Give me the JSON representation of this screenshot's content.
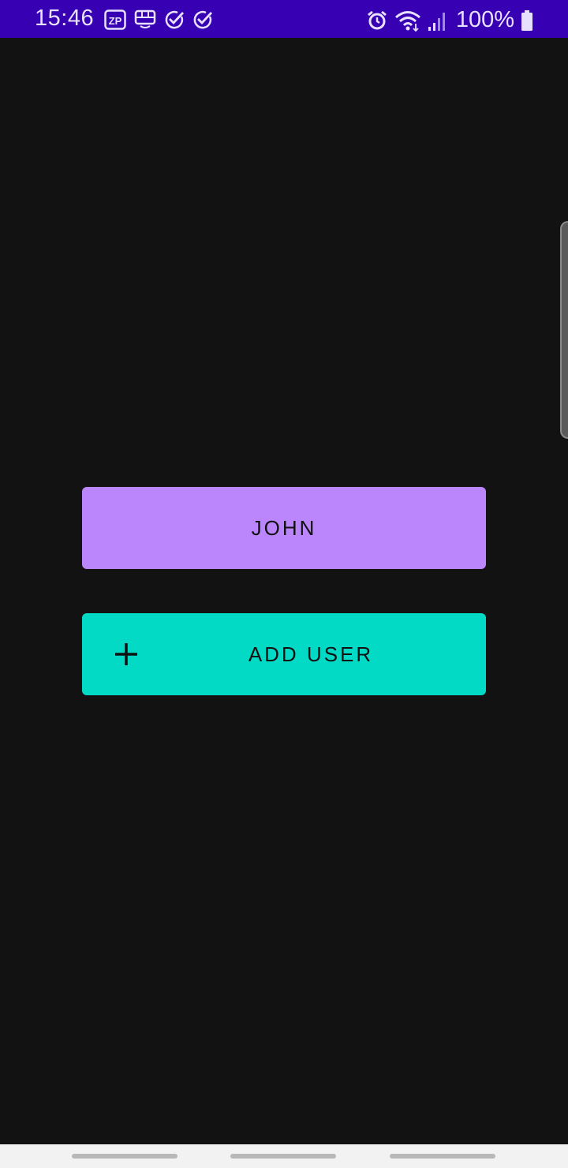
{
  "status_bar": {
    "time": "15:46",
    "battery_percent": "100%",
    "left_icons": [
      "zp-app-icon",
      "bus-icon",
      "check-circle-icon",
      "check-circle-icon"
    ],
    "right_icons": [
      "alarm-icon",
      "wifi-icon",
      "signal-icon",
      "battery-icon"
    ],
    "background_color": "#3700b3"
  },
  "main": {
    "user_button_label": "JOHN",
    "add_user_label": "ADD USER",
    "add_user_icon": "plus-icon",
    "user_button_color": "#bb86fc",
    "add_user_color": "#03dac5",
    "background_color": "#121212"
  },
  "nav_bar": {
    "pills": 3
  }
}
